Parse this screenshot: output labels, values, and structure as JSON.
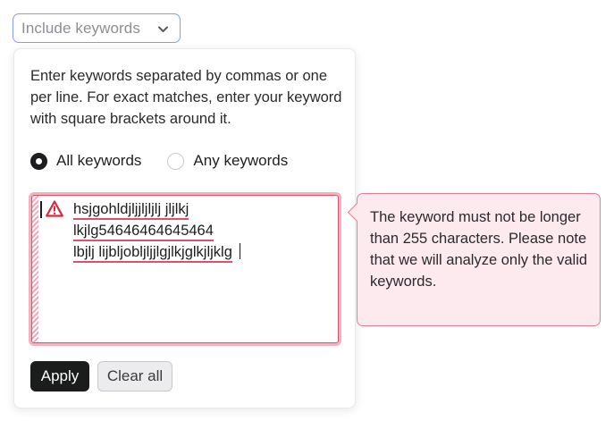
{
  "dropdown": {
    "label": "Include keywords",
    "chevron_icon": "chevron-down-icon"
  },
  "panel": {
    "description": "Enter keywords separated by commas or one per line. For exact matches, enter your keyword with square brackets around it.",
    "match_mode": {
      "options": [
        {
          "label": "All keywords",
          "checked": true
        },
        {
          "label": "Any keywords",
          "checked": false
        }
      ]
    },
    "keywords": {
      "warning_icon": "warning-triangle-icon",
      "lines": [
        "hsjgohldjljjljljlj jljlkj",
        "lkjlg54646464645464",
        "lbjlj lijbljobljljjlgjlkjglkjljklg"
      ]
    },
    "buttons": {
      "apply": "Apply",
      "clear_all": "Clear all"
    }
  },
  "error_tooltip": {
    "message": "The keyword must not be longer than 255 characters. Please note that we will analyze only the valid keywords."
  },
  "colors": {
    "trigger_border": "#8b9bf0",
    "error_border": "#d9536e",
    "error_fill": "#fdeaee",
    "primary_button": "#1a1d1b"
  }
}
